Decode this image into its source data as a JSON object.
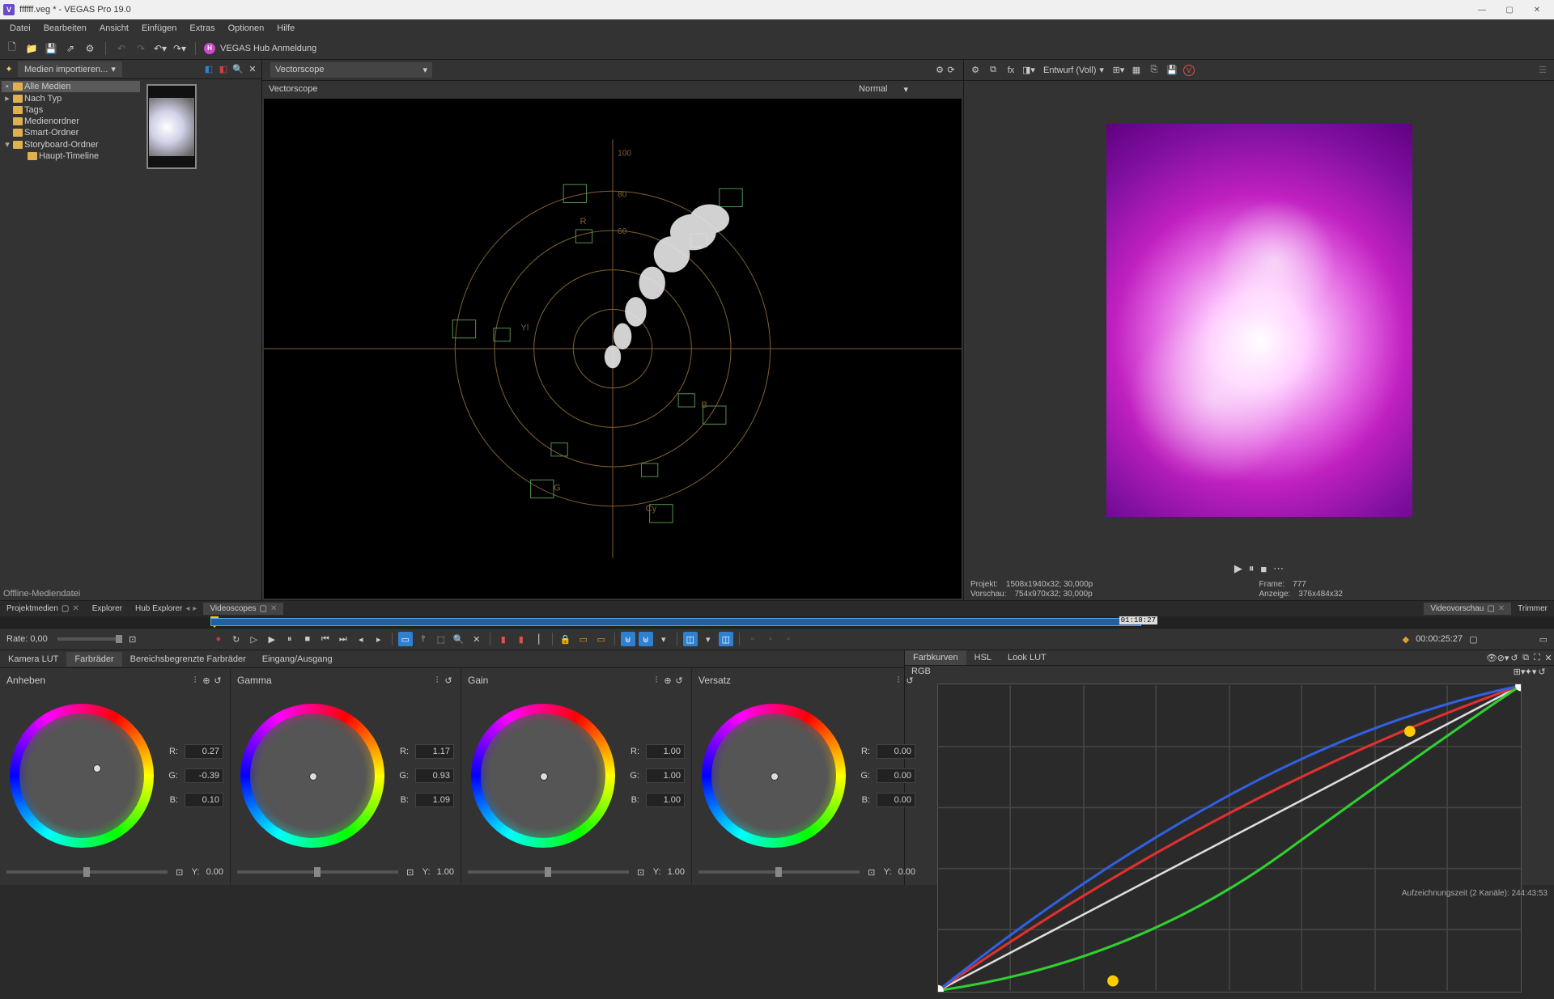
{
  "titlebar": {
    "title": "ffffff.veg * - VEGAS Pro 19.0"
  },
  "menu": {
    "items": [
      "Datei",
      "Bearbeiten",
      "Ansicht",
      "Einfügen",
      "Extras",
      "Optionen",
      "Hilfe"
    ]
  },
  "hub": {
    "label": "VEGAS Hub Anmeldung"
  },
  "media": {
    "import": "Medien importieren...",
    "tree": {
      "all": "Alle Medien",
      "by_type": "Nach Typ",
      "tags": "Tags",
      "folders": "Medienordner",
      "smart": "Smart-Ordner",
      "storyboard": "Storyboard-Ordner",
      "main_timeline": "Haupt-Timeline"
    },
    "offline": "Offline-Mediendatei"
  },
  "scope": {
    "select": "Vectorscope",
    "title": "Vectorscope",
    "mode": "Normal"
  },
  "preview": {
    "design": "Entwurf (Voll)",
    "info": {
      "project_lbl": "Projekt:",
      "project_val": "1508x1940x32; 30,000p",
      "preview_lbl": "Vorschau:",
      "preview_val": "754x970x32; 30,000p",
      "frame_lbl": "Frame:",
      "frame_val": "777",
      "display_lbl": "Anzeige:",
      "display_val": "376x484x32"
    }
  },
  "bottom_tabs": {
    "project_media": "Projektmedien",
    "explorer": "Explorer",
    "hub": "Hub Explorer",
    "scopes": "Videoscopes",
    "preview": "Videovorschau",
    "trimmer": "Trimmer"
  },
  "timeline": {
    "clip_tc": "01:18:27"
  },
  "transport": {
    "rate": "Rate: 0,00",
    "timecode": "00:00:25:27"
  },
  "cg_tabs": {
    "cam": "Kamera LUT",
    "wheels": "Farbräder",
    "limited": "Bereichsbegrenzte Farbräder",
    "io": "Eingang/Ausgang"
  },
  "wheels": {
    "lift": {
      "title": "Anheben",
      "r": "0.27",
      "g": "-0.39",
      "b": "0.10",
      "y": "0.00"
    },
    "gamma": {
      "title": "Gamma",
      "r": "1.17",
      "g": "0.93",
      "b": "1.09",
      "y": "1.00"
    },
    "gain": {
      "title": "Gain",
      "r": "1.00",
      "g": "1.00",
      "b": "1.00",
      "y": "1.00"
    },
    "offset": {
      "title": "Versatz",
      "r": "0.00",
      "g": "0.00",
      "b": "0.00",
      "y": "0.00"
    },
    "labels": {
      "r": "R:",
      "g": "G:",
      "b": "B:",
      "y": "Y:"
    }
  },
  "curves_tabs": {
    "curves": "Farbkurven",
    "hsl": "HSL",
    "lut": "Look LUT"
  },
  "curves": {
    "channel": "RGB"
  },
  "status": {
    "text": "Aufzeichnungszeit (2 Kanäle):  244:43:53"
  },
  "chart_data": [
    {
      "type": "scatter",
      "title": "Vectorscope",
      "description": "Chroma vectorscope with concentric graticule rings at 20/40/60/80/100 and color targets R Yl G Cy B. Signal trace is a diagonal plume from center toward upper-right between R and Yl targets, reaching roughly the 80 ring.",
      "rings": [
        20,
        40,
        60,
        80,
        100
      ],
      "targets": [
        "R",
        "Yl",
        "G",
        "Cy",
        "B"
      ],
      "trace_direction_deg_from_up": 40,
      "trace_max_saturation_pct": 80
    },
    {
      "type": "line",
      "title": "RGB Curves",
      "xlabel": "",
      "ylabel": "",
      "xlim": [
        0,
        1
      ],
      "ylim": [
        0,
        1
      ],
      "series": [
        {
          "name": "Red",
          "color": "#e03030",
          "points": [
            [
              0,
              0
            ],
            [
              0.25,
              0.33
            ],
            [
              0.5,
              0.58
            ],
            [
              0.75,
              0.8
            ],
            [
              1,
              1
            ]
          ]
        },
        {
          "name": "Green",
          "color": "#30d030",
          "points": [
            [
              0,
              0
            ],
            [
              0.25,
              0.12
            ],
            [
              0.5,
              0.32
            ],
            [
              0.75,
              0.6
            ],
            [
              1,
              1
            ]
          ]
        },
        {
          "name": "Blue",
          "color": "#3060e0",
          "points": [
            [
              0,
              0
            ],
            [
              0.25,
              0.38
            ],
            [
              0.5,
              0.64
            ],
            [
              0.75,
              0.85
            ],
            [
              1,
              1
            ]
          ]
        },
        {
          "name": "Luma",
          "color": "#dddddd",
          "points": [
            [
              0,
              0
            ],
            [
              1,
              1
            ]
          ]
        }
      ],
      "control_points": [
        {
          "color": "yellow",
          "x": 0.3,
          "y": 0.03
        },
        {
          "color": "yellow",
          "x": 0.81,
          "y": 0.85
        }
      ]
    }
  ]
}
